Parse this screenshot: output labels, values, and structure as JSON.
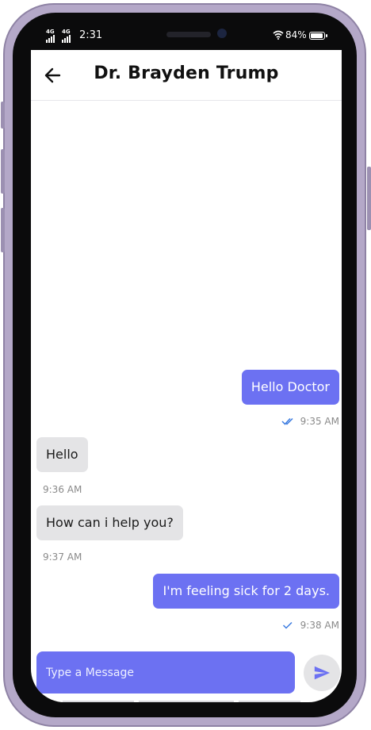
{
  "status_bar": {
    "network_1": "4G",
    "network_2": "4G",
    "time": "2:31",
    "battery": "84%"
  },
  "header": {
    "title": "Dr. Brayden Trump",
    "back_icon": "arrow-left-icon"
  },
  "messages": [
    {
      "text": "Hello Doctor",
      "time": "9:35 AM",
      "direction": "sent",
      "status": "read"
    },
    {
      "text": "Hello",
      "time": "9:36 AM",
      "direction": "received"
    },
    {
      "text": "How can i help you?",
      "time": "9:37 AM",
      "direction": "received"
    },
    {
      "text": "I'm feeling sick for 2 days.",
      "time": "9:38 AM",
      "direction": "sent",
      "status": "delivered"
    }
  ],
  "composer": {
    "placeholder": "Type a Message",
    "value": "",
    "send_icon": "send-icon"
  },
  "colors": {
    "accent": "#6c71f2",
    "received_bubble": "#e4e4e6",
    "tick_blue": "#3b7be0"
  }
}
